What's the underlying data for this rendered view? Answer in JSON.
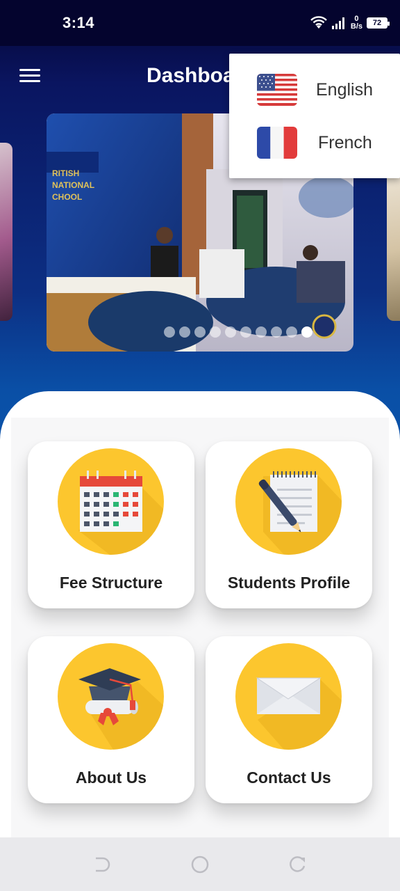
{
  "status_bar": {
    "time": "3:14",
    "speed_value": "0",
    "speed_unit": "B/s",
    "battery": "72"
  },
  "app_bar": {
    "title": "Dashboard",
    "menu_icon": "hamburger-menu-icon"
  },
  "carousel": {
    "slide_count": 10,
    "active_index": 9
  },
  "language_menu": {
    "items": [
      {
        "label": "English",
        "icon": "us-flag-icon"
      },
      {
        "label": "French",
        "icon": "france-flag-icon"
      }
    ]
  },
  "cards": [
    {
      "label": "Fee Structure",
      "icon": "calendar-icon"
    },
    {
      "label": "Students Profile",
      "icon": "notepad-pen-icon"
    },
    {
      "label": "About Us",
      "icon": "graduation-cap-icon"
    },
    {
      "label": "Contact Us",
      "icon": "envelope-icon"
    }
  ],
  "colors": {
    "header_gradient_top": "#050533",
    "header_gradient_bottom": "#0c57ad",
    "icon_circle": "#fcc62e"
  }
}
